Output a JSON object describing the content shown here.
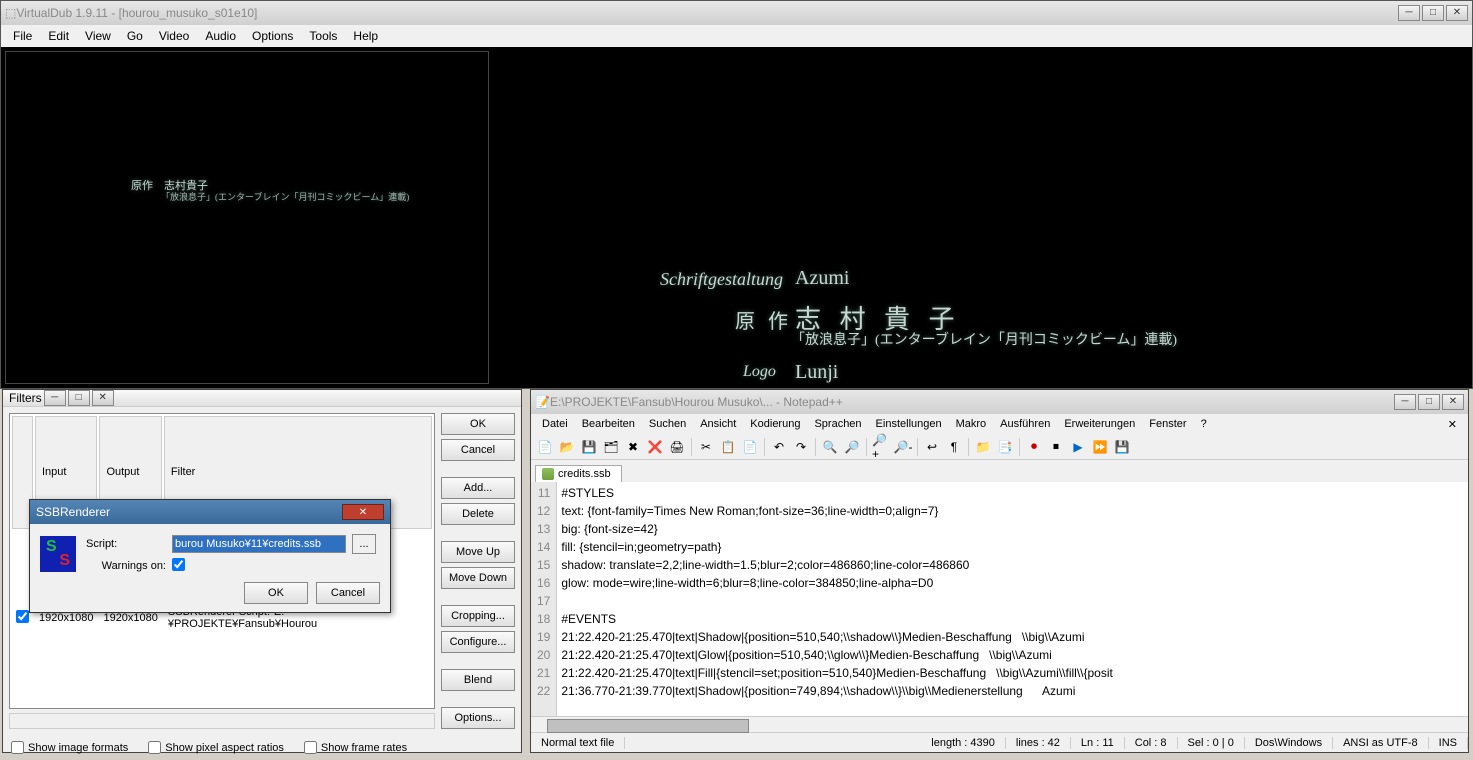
{
  "main": {
    "title": "VirtualDub 1.9.11 - [hourou_musuko_s01e10]",
    "menu": [
      "File",
      "Edit",
      "View",
      "Go",
      "Video",
      "Audio",
      "Options",
      "Tools",
      "Help"
    ]
  },
  "credits_left": {
    "line1": "原作　志村貴子",
    "line2": "「放浪息子」(エンターブレイン「月刊コミックビーム」連載)"
  },
  "credits_right": {
    "schrift_label": "Schriftgestaltung",
    "schrift_value": "Azumi",
    "gensaku_label": "原 作",
    "gensaku_value": "志 村 貴 子",
    "horo": "「放浪息子」(エンターブレイン「月刊コミックビーム」連載)",
    "logo_label": "Logo",
    "logo_value": "Lunji"
  },
  "filters": {
    "title": "Filters",
    "headers": {
      "input": "Input",
      "output": "Output",
      "filter": "Filter"
    },
    "row": {
      "input": "1920x1080",
      "output": "1920x1080",
      "filter": "SSBRenderer Script:\"E:¥PROJEKTE¥Fansub¥Hourou"
    },
    "buttons": {
      "ok": "OK",
      "cancel": "Cancel",
      "add": "Add...",
      "delete": "Delete",
      "moveup": "Move Up",
      "movedown": "Move Down",
      "cropping": "Cropping...",
      "configure": "Configure...",
      "blend": "Blend",
      "options": "Options..."
    },
    "checks": {
      "img": "Show image formats",
      "pix": "Show pixel aspect ratios",
      "fr": "Show frame rates"
    }
  },
  "ssb": {
    "title": "SSBRenderer",
    "script_label": "Script:",
    "script_value": "burou Musuko¥11¥credits.ssb",
    "warnings_label": "Warnings on:",
    "browse": "...",
    "ok": "OK",
    "cancel": "Cancel"
  },
  "npp": {
    "title": "E:\\PROJEKTE\\Fansub\\Hourou Musuko\\... - Notepad++",
    "menu": [
      "Datei",
      "Bearbeiten",
      "Suchen",
      "Ansicht",
      "Kodierung",
      "Sprachen",
      "Einstellungen",
      "Makro",
      "Ausführen",
      "Erweiterungen",
      "Fenster",
      "?"
    ],
    "tab": "credits.ssb",
    "lines": [
      {
        "n": "11",
        "t": "#STYLES"
      },
      {
        "n": "12",
        "t": "text: {font-family=Times New Roman;font-size=36;line-width=0;align=7}"
      },
      {
        "n": "13",
        "t": "big: {font-size=42}"
      },
      {
        "n": "14",
        "t": "fill: {stencil=in;geometry=path}"
      },
      {
        "n": "15",
        "t": "shadow: translate=2,2;line-width=1.5;blur=2;color=486860;line-color=486860"
      },
      {
        "n": "16",
        "t": "glow: mode=wire;line-width=6;blur=8;line-color=384850;line-alpha=D0"
      },
      {
        "n": "17",
        "t": ""
      },
      {
        "n": "18",
        "t": "#EVENTS"
      },
      {
        "n": "19",
        "t": "21:22.420-21:25.470|text|Shadow|{position=510,540;\\\\shadow\\\\}Medien-Beschaffung   \\\\big\\\\Azumi"
      },
      {
        "n": "20",
        "t": "21:22.420-21:25.470|text|Glow|{position=510,540;\\\\glow\\\\}Medien-Beschaffung   \\\\big\\\\Azumi"
      },
      {
        "n": "21",
        "t": "21:22.420-21:25.470|text|Fill|{stencil=set;position=510,540}Medien-Beschaffung   \\\\big\\\\Azumi\\\\fill\\\\{posit"
      },
      {
        "n": "22",
        "t": "21:36.770-21:39.770|text|Shadow|{position=749,894;\\\\shadow\\\\}\\\\big\\\\Medienerstellung      Azumi"
      }
    ],
    "status": {
      "type": "Normal text file",
      "length": "length : 4390",
      "lines": "lines : 42",
      "ln": "Ln : 11",
      "col": "Col : 8",
      "sel": "Sel : 0 | 0",
      "eol": "Dos\\Windows",
      "enc": "ANSI as UTF-8",
      "ins": "INS"
    }
  }
}
